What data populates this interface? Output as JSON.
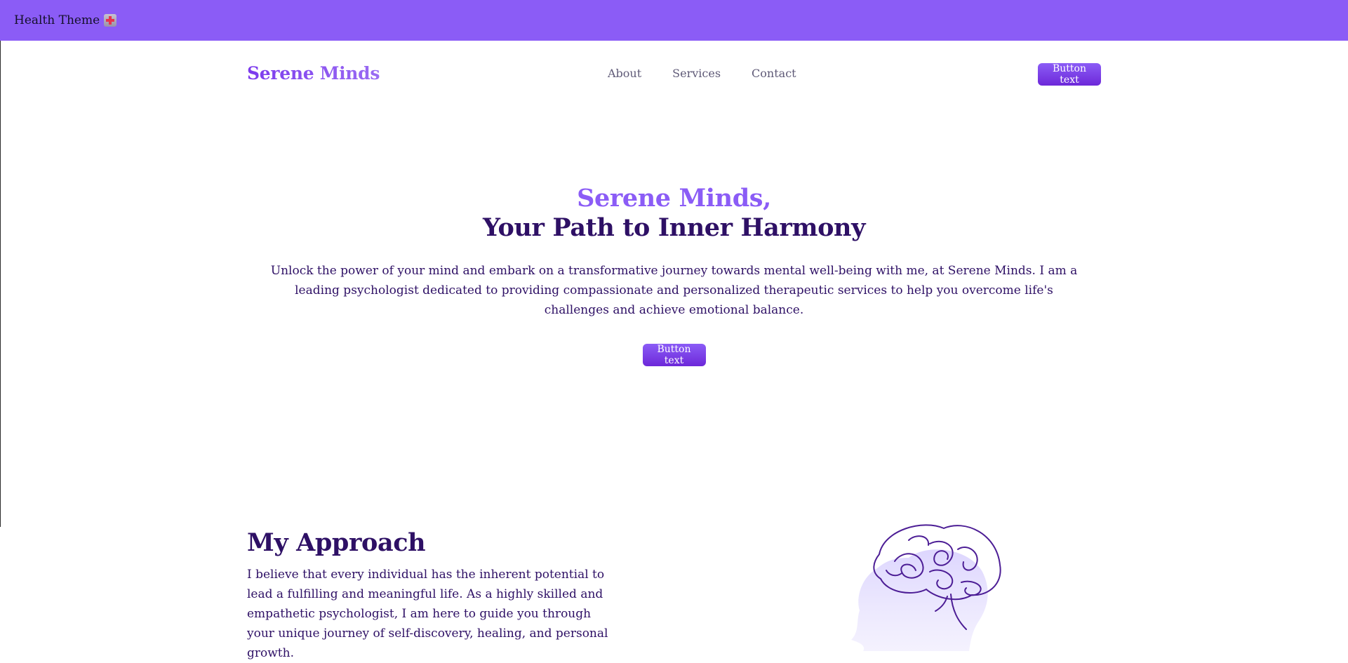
{
  "topbar": {
    "title": "Health Theme",
    "icon": "hospital-icon"
  },
  "header": {
    "brand": "Serene Minds",
    "nav": [
      "About",
      "Services",
      "Contact"
    ],
    "cta_label": "Button text"
  },
  "hero": {
    "title_line1": "Serene Minds,",
    "title_line2": "Your Path to Inner Harmony",
    "description": "Unlock the power of your mind and embark on a transformative journey towards mental well-being with me, at Serene Minds. I am a leading psychologist dedicated to providing compassionate and personalized therapeutic services to help you overcome life's challenges and achieve emotional balance.",
    "cta_label": "Button text"
  },
  "approach": {
    "heading": "My Approach",
    "body": "I believe that every individual has the inherent potential to lead a fulfilling and meaningful life. As a highly skilled and empathetic psychologist, I am here to guide you through your unique journey of self-discovery, healing, and personal growth."
  },
  "colors": {
    "topbar": "#8b5cf6",
    "accent": "#8b5cf6",
    "heading": "#2e1065",
    "nav_text": "#5f5a77",
    "button_start": "#8b5cf6",
    "button_end": "#6d28d9"
  },
  "illustration": {
    "icon": "head-brain-icon"
  }
}
